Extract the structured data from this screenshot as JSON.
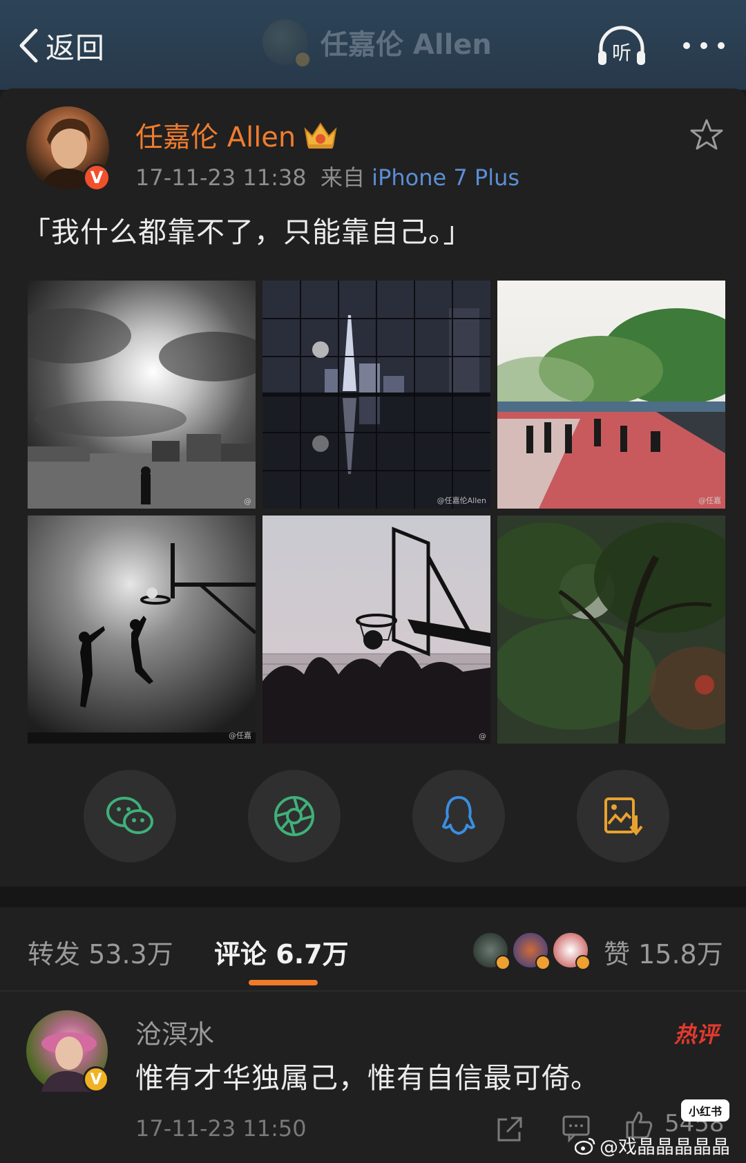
{
  "nav": {
    "back_label": "返回",
    "ghost_title": "任嘉伦 Allen",
    "listen_label": "听"
  },
  "post": {
    "author": "任嘉伦 Allen",
    "verified_mark": "V",
    "timestamp": "17-11-23 11:38",
    "source_prefix": "来自",
    "device": "iPhone 7 Plus",
    "text": "「我什么都靠不了，只能靠自己。」",
    "image_watermarks": [
      "@",
      "@任嘉伦Allen",
      "@任嘉",
      "@任嘉",
      "@"
    ]
  },
  "share": {
    "icons": [
      "wechat-icon",
      "moments-icon",
      "qq-icon",
      "save-image-icon"
    ]
  },
  "stats": {
    "repost_label": "转发",
    "repost_count": "53.3万",
    "comment_label": "评论",
    "comment_count": "6.7万",
    "like_label": "赞",
    "like_count": "15.8万"
  },
  "comment": {
    "name": "沧溟水",
    "verified_mark": "V",
    "hot_label": "热评",
    "text": "惟有才华独属己，惟有自信最可倚。",
    "timestamp": "17-11-23 11:50",
    "likes": "5458"
  },
  "overlay": {
    "xhs_badge": "小红书",
    "weibo_handle": "@戏晶晶晶晶晶"
  },
  "colors": {
    "accent": "#f07a2a",
    "author": "#ef7d2f",
    "link": "#5c8ed6",
    "hot": "#e23a2e"
  }
}
